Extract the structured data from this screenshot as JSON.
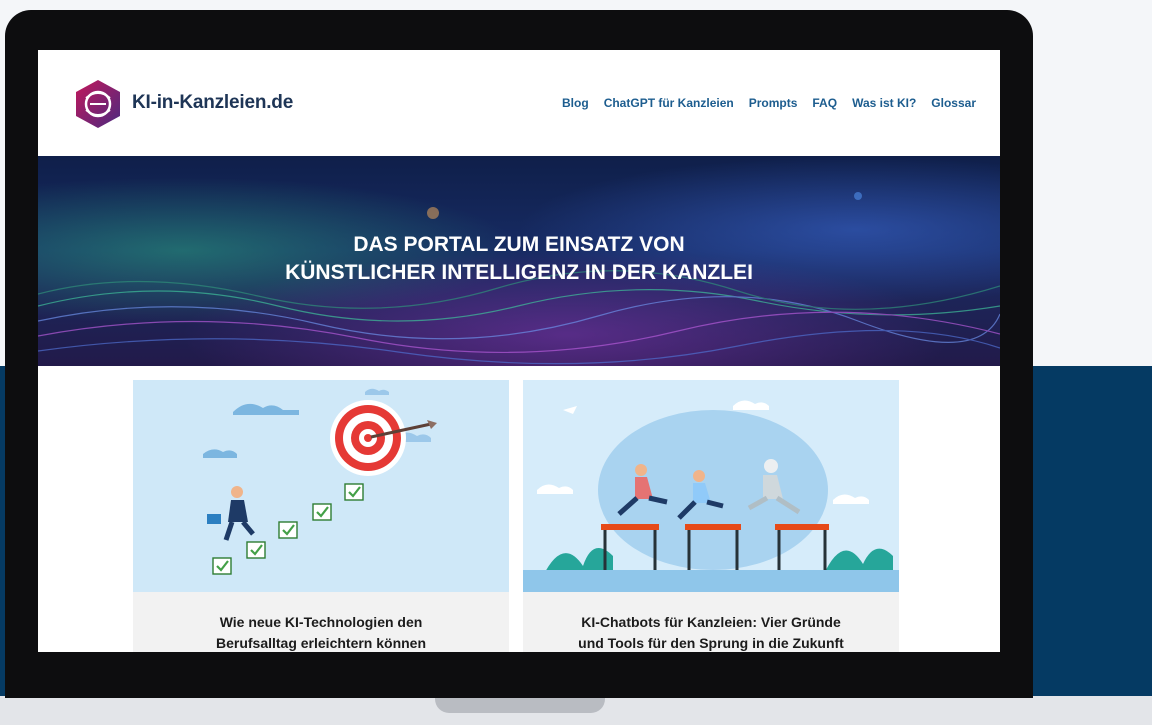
{
  "site": {
    "logo_text": "KI-in-Kanzleien.de",
    "nav": [
      "Blog",
      "ChatGPT für Kanzleien",
      "Prompts",
      "FAQ",
      "Was ist KI?",
      "Glossar"
    ]
  },
  "hero": {
    "line1": "DAS PORTAL ZUM EINSATZ VON",
    "line2": "KÜNSTLICHER INTELLIGENZ IN DER KANZLEI"
  },
  "cards": [
    {
      "line1": "Wie neue KI-Technologien den",
      "line2": "Berufsalltag erleichtern können"
    },
    {
      "line1": "KI-Chatbots für Kanzleien: Vier Gründe",
      "line2": "und Tools für den Sprung in die Zukunft"
    }
  ],
  "colors": {
    "navy": "#053a63",
    "nav_link": "#1d5d8f",
    "logo_magenta": "#b3175c",
    "logo_purple": "#5a2a7c",
    "card_sky": "#cfe8f8"
  }
}
